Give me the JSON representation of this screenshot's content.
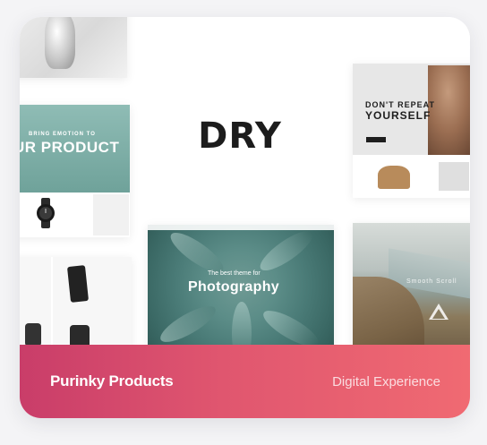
{
  "card": {
    "name": "Purinky Products",
    "category": "Digital Experience"
  },
  "collage": {
    "center_logo": "DRY",
    "product_tile": {
      "tagline": "BRING EMOTION TO",
      "headline": "UR PRODUCT"
    },
    "dry_tile": {
      "line1": "DON'T REPEAT",
      "line2": "YOURSELF"
    },
    "photo_tile": {
      "tagline": "The best theme for",
      "headline": "Photography"
    },
    "coast_tile": {
      "caption": "Smooth Scroll"
    }
  },
  "colors": {
    "gradient_start": "#c93d69",
    "gradient_end": "#f06a72"
  }
}
